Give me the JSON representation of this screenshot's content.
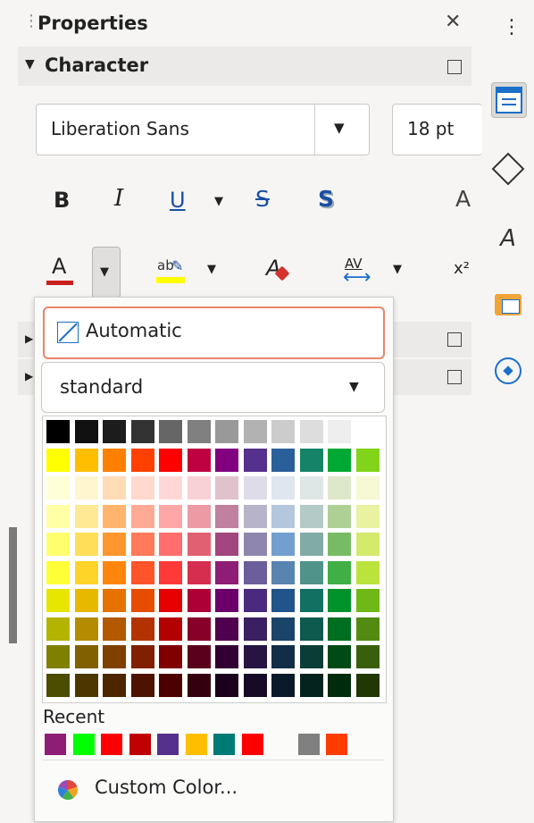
{
  "panel": {
    "title": "Properties",
    "close_glyph": "✕",
    "menu_glyph": "⋮",
    "drag_handle_glyph": "⋮"
  },
  "character": {
    "section_label": "Character",
    "font_name": "Liberation Sans",
    "font_size": "18 pt"
  },
  "toolbar_row1": {
    "bold": "B",
    "italic": "I",
    "underline": "U",
    "strike": "S",
    "shadow": "S",
    "grow": "A"
  },
  "toolbar_row2": {
    "font_color_letter": "A",
    "highlight_letters": "ab",
    "spacing_letters": "AV",
    "superscript": "x²"
  },
  "color_popup": {
    "automatic_label": "Automatic",
    "palette_name": "standard",
    "recent_label": "Recent",
    "custom_label": "Custom Color..."
  },
  "palette": [
    [
      "#000000",
      "#111111",
      "#1c1c1c",
      "#333333",
      "#666666",
      "#808080",
      "#999999",
      "#b2b2b2",
      "#cccccc",
      "#dddddd",
      "#eeeeee",
      "#ffffff"
    ],
    [
      "#ffff00",
      "#ffbf00",
      "#ff8000",
      "#ff4000",
      "#ff0000",
      "#bf0041",
      "#800080",
      "#55308d",
      "#2a6099",
      "#158466",
      "#00a933",
      "#81d41a"
    ],
    [
      "#ffffd7",
      "#fff5ce",
      "#ffdbb6",
      "#ffd8ce",
      "#ffd7d7",
      "#f7d1d5",
      "#e0c2cd",
      "#dedce6",
      "#dee6ef",
      "#dee7e5",
      "#dde8cb",
      "#f6f9d4"
    ],
    [
      "#ffffa6",
      "#ffe994",
      "#ffb66c",
      "#ffaa95",
      "#ffa6a6",
      "#ec9ba4",
      "#bf819e",
      "#b7b3ca",
      "#b4c7dc",
      "#b3cac7",
      "#afd095",
      "#e8f2a1"
    ],
    [
      "#ffff6d",
      "#ffde59",
      "#ff972f",
      "#ff7b59",
      "#ff6d6d",
      "#e16173",
      "#a1467e",
      "#8e86ae",
      "#729fcf",
      "#81aca6",
      "#77bc65",
      "#d4ea6b"
    ],
    [
      "#ffff38",
      "#ffd428",
      "#ff860d",
      "#ff5429",
      "#ff3838",
      "#d62e4e",
      "#8d1d75",
      "#6b5e9b",
      "#5983b0",
      "#50938a",
      "#3faf46",
      "#bbe33d"
    ],
    [
      "#e6e600",
      "#e6b800",
      "#e67300",
      "#e64d00",
      "#e60000",
      "#ac0036",
      "#6b006b",
      "#4a2a7f",
      "#21548b",
      "#127062",
      "#00922b",
      "#6fb817"
    ],
    [
      "#b3b300",
      "#b38c00",
      "#b35900",
      "#b33300",
      "#b30000",
      "#870029",
      "#4f004f",
      "#3a1f63",
      "#1b446a",
      "#0e5a4e",
      "#006e20",
      "#538a12"
    ],
    [
      "#808000",
      "#806000",
      "#804000",
      "#802000",
      "#800000",
      "#5a001c",
      "#330033",
      "#271443",
      "#122d47",
      "#093d35",
      "#004a15",
      "#38600c"
    ],
    [
      "#4d4d00",
      "#4d3600",
      "#4d2600",
      "#4d1300",
      "#4d0000",
      "#340010",
      "#1a001a",
      "#170a27",
      "#0a1a2a",
      "#05231e",
      "#002b0c",
      "#213805"
    ]
  ],
  "recent_colors": [
    "#8d1d75",
    "#00ff00",
    "#ff0000",
    "#c00000",
    "#55308d",
    "#ffbf00",
    "#007a75",
    "#ff0000",
    "",
    "#808080",
    "#ff3c00"
  ],
  "sidebar": {
    "icons": [
      "properties-icon",
      "shapes-icon",
      "styles-icon",
      "gallery-icon",
      "navigator-icon"
    ]
  }
}
